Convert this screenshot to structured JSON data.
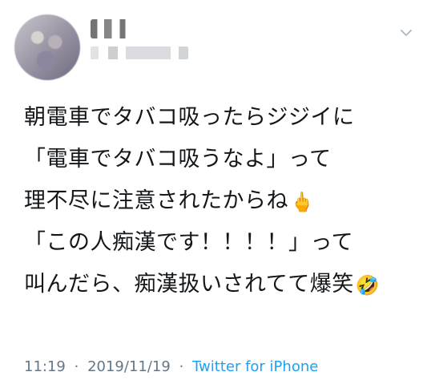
{
  "tweet": {
    "text_lines": [
      "朝電車でタバコ吸ったらジジイに",
      "「電車でタバコ吸うなよ」って",
      "理不尽に注意されたからね",
      "「この人痴漢です！！！！」って",
      "叫んだら、痴漢扱いされてて爆笑"
    ],
    "emoji_1": "🖕",
    "emoji_2": "🤣",
    "time": "11:19",
    "separator": "·",
    "date": "2019/11/19",
    "separator2": "·",
    "source": "Twitter for iPhone"
  },
  "icons": {
    "menu": "chevron-down-icon",
    "avatar": "avatar-blurred"
  },
  "colors": {
    "text": "#14171a",
    "meta": "#657786",
    "source": "#1da1f2",
    "chevron": "#aab8c2"
  }
}
